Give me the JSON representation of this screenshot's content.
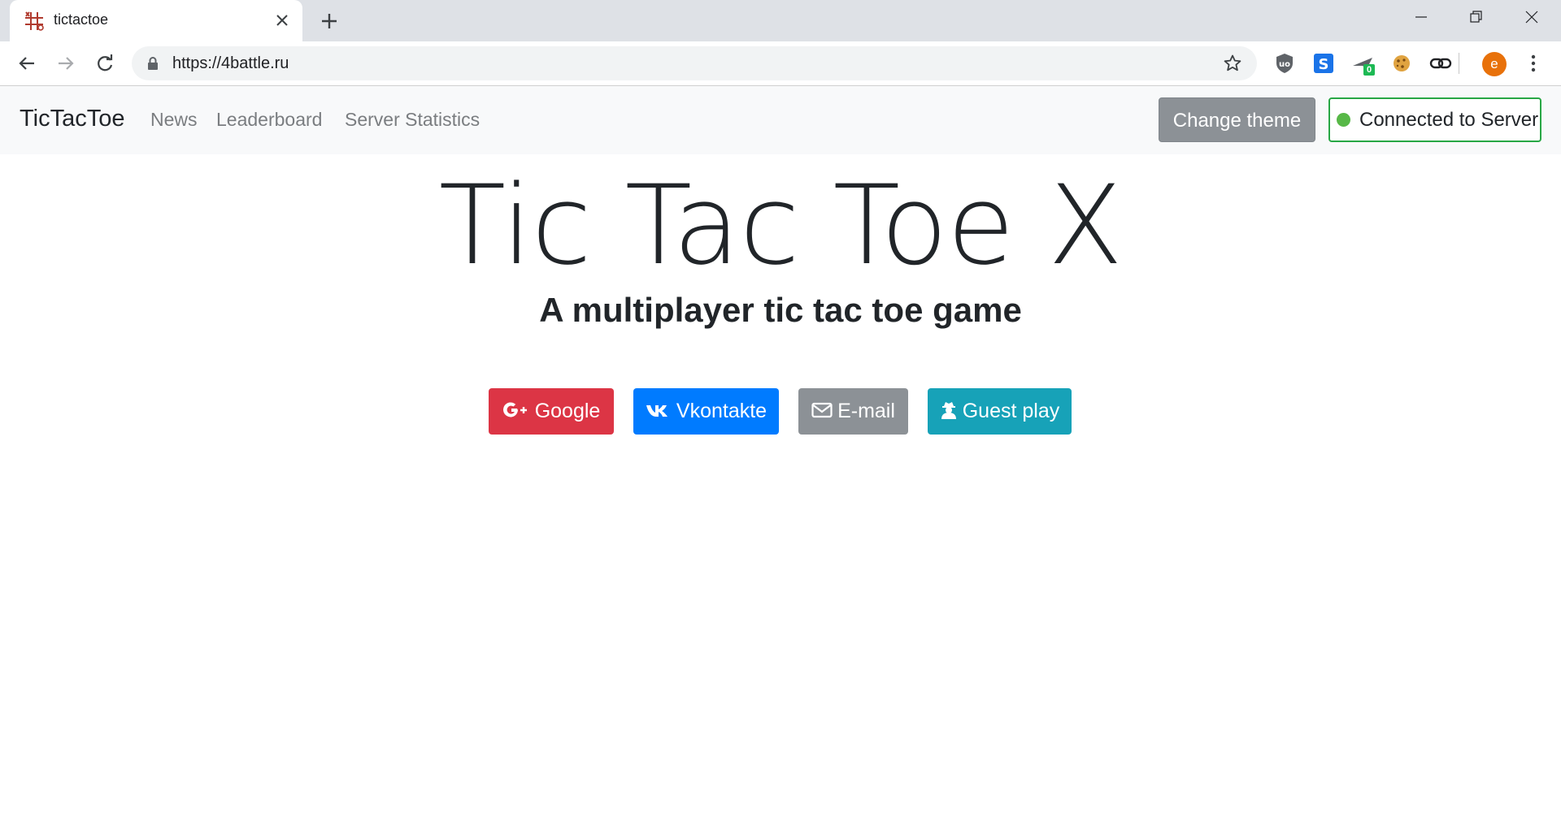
{
  "browser": {
    "tab_title": "tictactoe",
    "url": "https://4battle.ru",
    "profile_initial": "e",
    "extension_badge": "0"
  },
  "navbar": {
    "brand": "TicTacToe",
    "links": [
      "News",
      "Leaderboard",
      "Server Statistics"
    ],
    "change_theme": "Change theme",
    "connection_status": "Connected to Server",
    "connection_color": "#57b847"
  },
  "hero": {
    "title": "Tic Tac Toe X",
    "subtitle": "A multiplayer tic tac toe game"
  },
  "login_buttons": [
    {
      "label": "Google",
      "icon": "google-plus-icon",
      "color": "#dc3545"
    },
    {
      "label": "Vkontakte",
      "icon": "vk-icon",
      "color": "#007bff"
    },
    {
      "label": "E-mail",
      "icon": "envelope-icon",
      "color": "#8c9196"
    },
    {
      "label": "Guest play",
      "icon": "user-secret-icon",
      "color": "#17a2b8"
    }
  ]
}
